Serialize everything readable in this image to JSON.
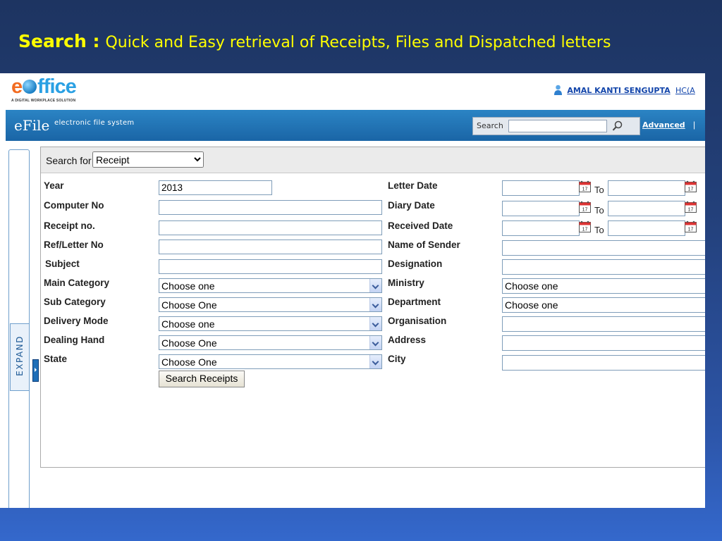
{
  "slide": {
    "title_bold": "Search :",
    "title_rest": "Quick and Easy retrieval of Receipts, Files and Dispatched letters"
  },
  "header": {
    "logo_e": "e",
    "logo_rest": "ffice",
    "logo_tagline": "A DIGITAL WORKPLACE SOLUTION",
    "user_name": "AMAL KANTI SENGUPTA",
    "user_role": "HC(A"
  },
  "nav": {
    "brand": "eFile",
    "subtitle": "electronic file system",
    "search_label": "Search",
    "search_value": "",
    "advanced_label": "Advanced",
    "separator": "|"
  },
  "sidebar": {
    "expand_label": "EXPAND"
  },
  "form": {
    "search_for_label": "Search for",
    "search_for_value": "Receipt",
    "to_label": "To",
    "left": [
      {
        "label": "Year",
        "value": "2013"
      },
      {
        "label": "Computer No",
        "value": ""
      },
      {
        "label": "Receipt no.",
        "value": ""
      },
      {
        "label": "Ref/Letter No",
        "value": ""
      },
      {
        "label": "Subject",
        "value": ""
      },
      {
        "label": "Main Category",
        "value": "Choose one"
      },
      {
        "label": "Sub Category",
        "value": "Choose One"
      },
      {
        "label": "Delivery Mode",
        "value": "Choose one"
      },
      {
        "label": "Dealing Hand",
        "value": "Choose One"
      },
      {
        "label": "State",
        "value": "Choose One"
      }
    ],
    "right": [
      {
        "label": "Letter Date",
        "from": "",
        "to": ""
      },
      {
        "label": "Diary Date",
        "from": "",
        "to": ""
      },
      {
        "label": "Received Date",
        "from": "",
        "to": ""
      },
      {
        "label": "Name of Sender",
        "value": ""
      },
      {
        "label": "Designation",
        "value": ""
      },
      {
        "label": "Ministry",
        "value": "Choose one"
      },
      {
        "label": "Department",
        "value": "Choose one"
      },
      {
        "label": "Organisation",
        "value": ""
      },
      {
        "label": "Address",
        "value": ""
      },
      {
        "label": "City",
        "value": ""
      }
    ],
    "calendar_day": "17",
    "submit_label": "Search Receipts"
  },
  "colors": {
    "accent": "#1a65a6",
    "title": "#ffff00",
    "link": "#1144aa"
  }
}
